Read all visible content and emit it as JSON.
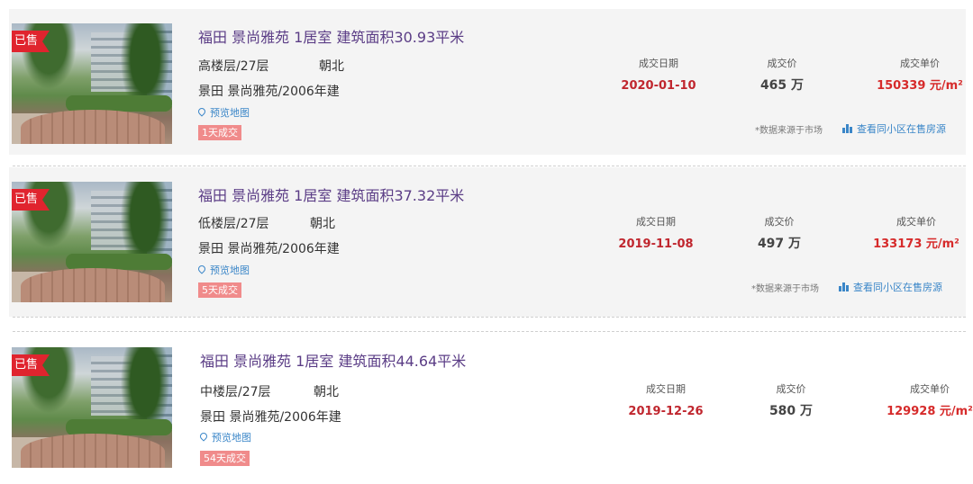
{
  "labels": {
    "date_caption": "成交日期",
    "price_caption": "成交价",
    "unit_price_caption": "成交单价",
    "map_link": "预览地图",
    "source_note": "*数据来源于市场",
    "nearby_link": "查看同小区在售房源",
    "sold_tag": "已售"
  },
  "colors": {
    "title": "#5b3d86",
    "sold_tag": "#e0242e",
    "price_red": "#d62a2a",
    "link_blue": "#3a86c8"
  },
  "listings": [
    {
      "title": "福田 景尚雅苑 1居室 建筑面积30.93平米",
      "floor": "高楼层/27层",
      "orientation": "朝北",
      "community": "景田 景尚雅苑/2006年建",
      "days": "1天成交",
      "deal_date": "2020-01-10",
      "price": "465 万",
      "unit_price": "150339 元/m²"
    },
    {
      "title": "福田 景尚雅苑 1居室 建筑面积37.32平米",
      "floor": "低楼层/27层",
      "orientation": "朝北",
      "community": "景田 景尚雅苑/2006年建",
      "days": "5天成交",
      "deal_date": "2019-11-08",
      "price": "497 万",
      "unit_price": "133173 元/m²"
    },
    {
      "title": "福田 景尚雅苑 1居室 建筑面积44.64平米",
      "floor": "中楼层/27层",
      "orientation": "朝北",
      "community": "景田 景尚雅苑/2006年建",
      "days": "54天成交",
      "deal_date": "2019-12-26",
      "price": "580 万",
      "unit_price": "129928 元/m²"
    }
  ]
}
